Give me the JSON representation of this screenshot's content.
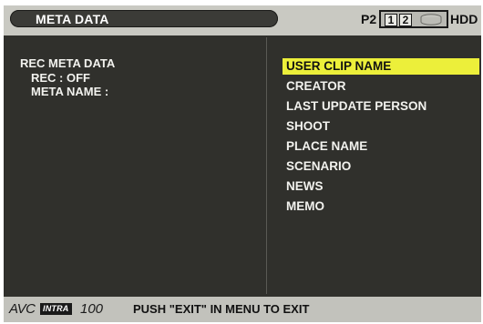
{
  "header": {
    "title": "META DATA",
    "media_label": "P2",
    "slot_1": "1",
    "slot_2": "2",
    "hdd_label": "HDD",
    "hdd_icon": "hdd-icon"
  },
  "left_panel": {
    "heading": "REC META DATA",
    "rec_line": "REC : OFF",
    "meta_name_line": "META NAME :"
  },
  "menu": {
    "selected_index": 0,
    "items": [
      "USER CLIP NAME",
      "CREATOR",
      "LAST UPDATE PERSON",
      "SHOOT",
      "PLACE NAME",
      "SCENARIO",
      "NEWS",
      "MEMO"
    ]
  },
  "footer": {
    "logo_avc": "AVC",
    "logo_intra": "INTRA",
    "logo_100": "100",
    "message": "PUSH \"EXIT\" IN MENU TO EXIT"
  },
  "colors": {
    "screen_bg": "#30302c",
    "bar_bg": "#c9c9c2",
    "highlight": "#ecef3a",
    "text": "#f2f2ee"
  }
}
